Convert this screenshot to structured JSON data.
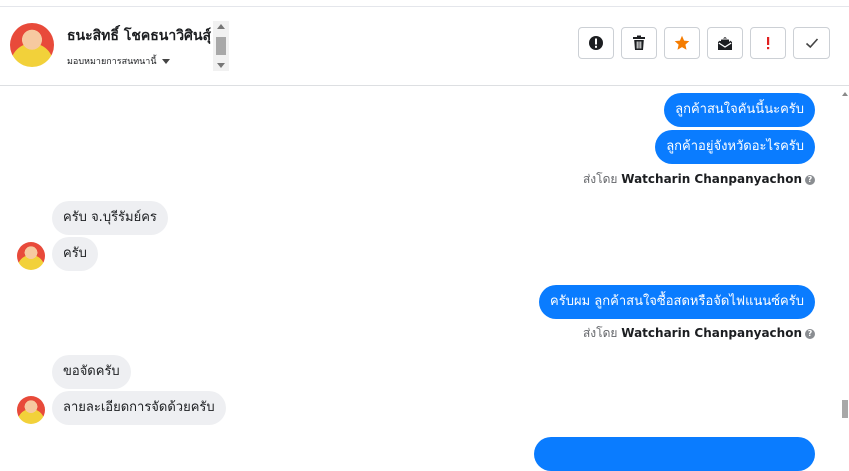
{
  "header": {
    "contact_name": "ธนะสิทธิ์ โชคธนาวิศินสุ์",
    "assign_label": "มอบหมายการสนทนานี้",
    "toolbar": [
      {
        "name": "report-spam-button",
        "icon": "exclamation-circle-icon"
      },
      {
        "name": "delete-button",
        "icon": "trash-icon"
      },
      {
        "name": "star-button",
        "icon": "star-icon",
        "color": "#f57c00"
      },
      {
        "name": "mark-unread-button",
        "icon": "envelope-open-icon"
      },
      {
        "name": "follow-up-button",
        "icon": "exclamation-icon",
        "color": "#e02020"
      },
      {
        "name": "mark-done-button",
        "icon": "checkmark-icon"
      }
    ]
  },
  "messages": [
    {
      "side": "out",
      "text": "ลูกค้าสนใจคันนี้นะครับ"
    },
    {
      "side": "out",
      "text": "ลูกค้าอยู่จังหวัดอะไรครับ"
    },
    {
      "side": "in",
      "text": "ครับ จ.บุรีรัมย์คร"
    },
    {
      "side": "in",
      "text": "ครับ"
    },
    {
      "side": "out",
      "text": "ครับผม ลูกค้าสนใจซื้อสดหรือจัดไฟแนนซ์ครับ"
    },
    {
      "side": "in",
      "text": "ขอจัดครับ"
    },
    {
      "side": "in",
      "text": "ลายละเอียดการจัดด้วยครับ"
    }
  ],
  "sent_by": {
    "prefix": "ส่งโดย",
    "agent": "Watcharin Chanpanyachon"
  },
  "colors": {
    "outgoing_bubble": "#0a7cff",
    "incoming_bubble": "#eeeff2",
    "star": "#f57c00",
    "flag": "#e02020"
  }
}
